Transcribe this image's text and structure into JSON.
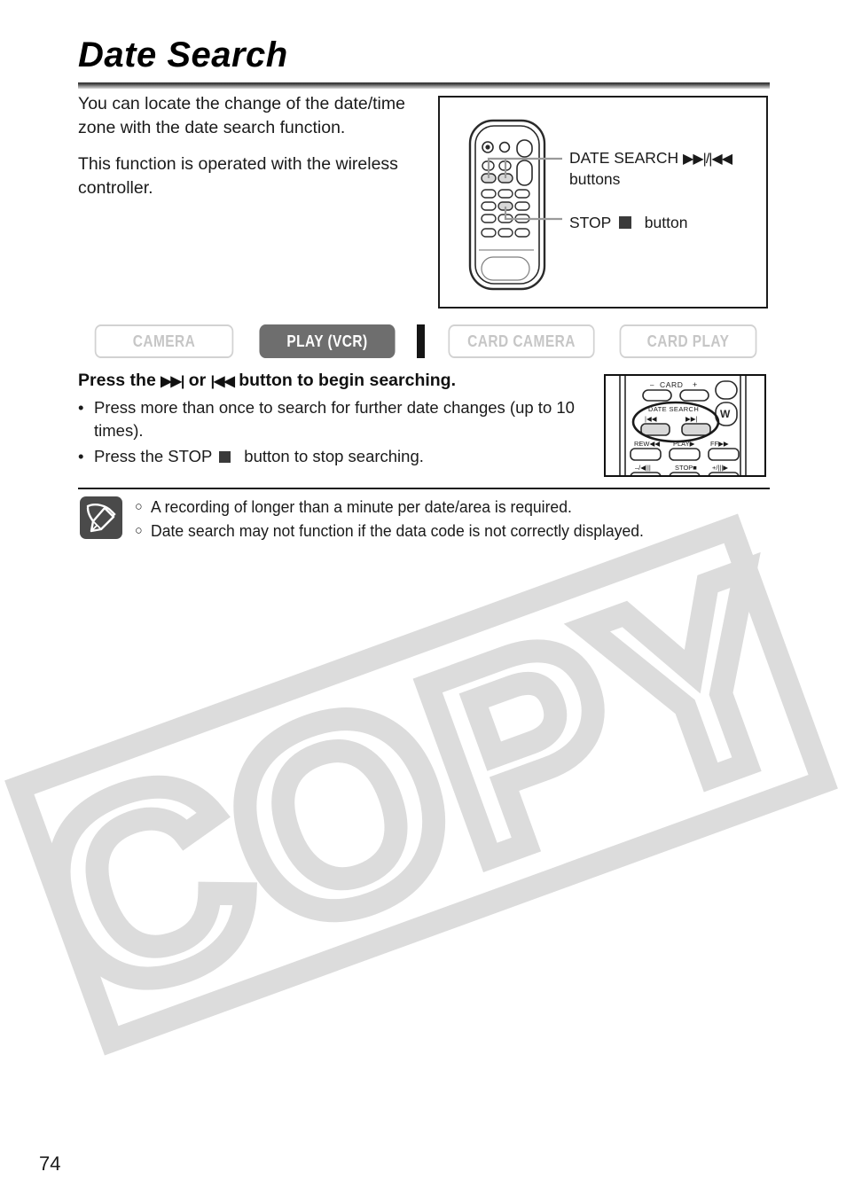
{
  "page": {
    "title": "Date Search",
    "number": "74",
    "watermark": "COPY"
  },
  "intro": {
    "paragraph_1": "You can locate the change of the date/time zone with the date search function.",
    "paragraph_2": "This function is operated with the wireless controller."
  },
  "figure": {
    "callout_date_search_label": "DATE SEARCH",
    "callout_date_search_symbols": "▶▶|/|◀◀",
    "callout_date_search_suffix": "buttons",
    "callout_stop_label": "STOP",
    "callout_stop_suffix": "button"
  },
  "mode_tabs": [
    {
      "label": "CAMERA",
      "active": false
    },
    {
      "label": "PLAY (VCR)",
      "active": true
    },
    {
      "label": "CARD CAMERA",
      "active": false
    },
    {
      "label": "CARD PLAY",
      "active": false
    }
  ],
  "procedure": {
    "heading_before": "Press the",
    "heading_symbol_forward": "▶▶|",
    "heading_middle": "or",
    "heading_symbol_rewind": "|◀◀",
    "heading_after": "button to begin searching.",
    "bullet_marker": "•",
    "bullets": [
      {
        "text": "Press more than once to search for further date changes (up to 10 times)."
      },
      {
        "text_before": "Press the STOP",
        "text_after": "button to stop searching."
      }
    ]
  },
  "inset_remote": {
    "card_label": "CARD",
    "card_minus": "–",
    "card_plus": "+",
    "date_search_label": "DATE SEARCH",
    "rewind_symbol": "|◀◀",
    "forward_symbol": "▶▶|",
    "zoom_wide_label": "W",
    "row_rew": "REW",
    "row_play": "PLAY",
    "row_ff": "FF",
    "row_minus_slow": "–/◀||",
    "row_stop": "STOP",
    "row_plus_slow": "+/||▶"
  },
  "notes": {
    "bullet": "○",
    "items": [
      "A recording of longer than a minute per date/area is required.",
      "Date search may not function if the data code is not correctly displayed."
    ]
  },
  "colors": {
    "active_tab_bg": "#6e6e6e",
    "inactive_tab_border": "#d2d2d2",
    "inactive_tab_text": "#c6c6c6",
    "separator": "#151515",
    "note_icon_bg": "#4a4a4a",
    "watermark": "#dcdcdc",
    "remote_button_fill": "#d8d8d8"
  }
}
